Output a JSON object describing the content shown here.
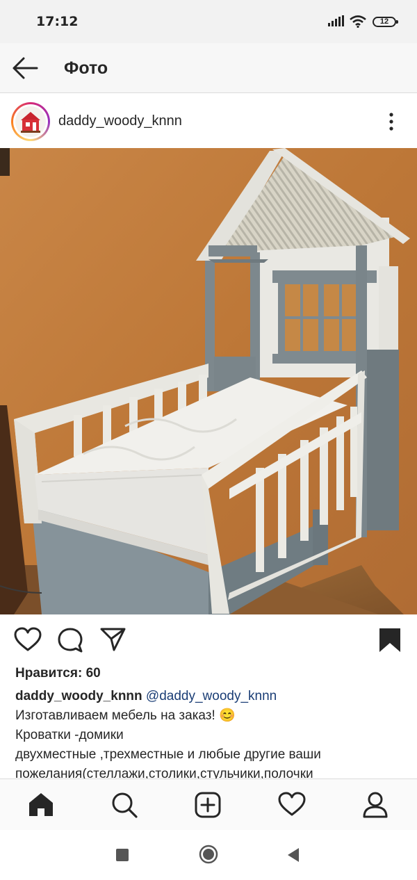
{
  "status_bar": {
    "time": "17:12",
    "battery": "12",
    "icons": [
      "signal-icon",
      "wifi-icon",
      "battery-icon"
    ]
  },
  "app_bar": {
    "title": "Фото",
    "back_icon": "arrow-left-icon"
  },
  "post": {
    "username": "daddy_woody_knnn",
    "more_icon": "more-vertical-icon",
    "photo_subject": "bed-house-photo",
    "likes": "Нравится: 60",
    "caption": {
      "username": "daddy_woody_knnn",
      "mention": "@daddy_woody_knnn",
      "line1": "Изготавливаем мебель на заказ! 😊",
      "line2": "Кроватки -домики",
      "line3": "двухместные ,трехместные и любые другие ваши",
      "line4": "пожелания(стеллажи,столики,стульчики,полочки"
    }
  },
  "actions": [
    "heart-icon",
    "comment-icon",
    "share-icon",
    "bookmark-icon"
  ],
  "bottom_nav": [
    "home-icon",
    "search-icon",
    "add-post-icon",
    "activity-heart-icon",
    "profile-icon"
  ],
  "system_nav": [
    "recents-square-icon",
    "home-circle-icon",
    "back-triangle-icon"
  ],
  "colors": {
    "mention": "#1a3d75",
    "wall": "#c07a3c",
    "bed_gray": "#7f8a8f",
    "bed_white": "#ecebe6"
  }
}
